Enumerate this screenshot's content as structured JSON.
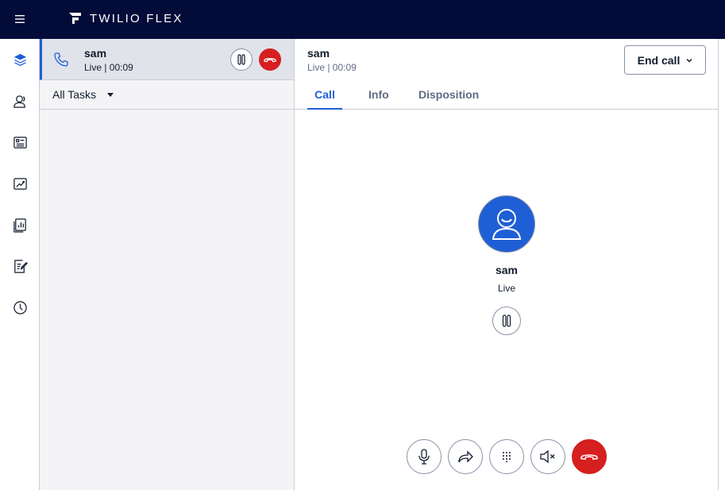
{
  "app": {
    "brand": "TWILIO FLEX"
  },
  "nav": {
    "items": [
      "layers-icon",
      "contacts-icon",
      "directory-icon",
      "insights-icon",
      "reports-icon",
      "queue-stats-icon",
      "history-icon"
    ]
  },
  "task": {
    "name": "sam",
    "status": "Live | 00:09"
  },
  "filter": {
    "label": "All Tasks"
  },
  "header": {
    "name": "sam",
    "status": "Live | 00:09",
    "end_call_label": "End call"
  },
  "tabs": [
    {
      "label": "Call",
      "active": true
    },
    {
      "label": "Info",
      "active": false
    },
    {
      "label": "Disposition",
      "active": false
    }
  ],
  "caller": {
    "name": "sam",
    "status": "Live"
  },
  "colors": {
    "accent": "#1f5fd6",
    "danger": "#d61f1f",
    "topbar": "#030b38"
  }
}
